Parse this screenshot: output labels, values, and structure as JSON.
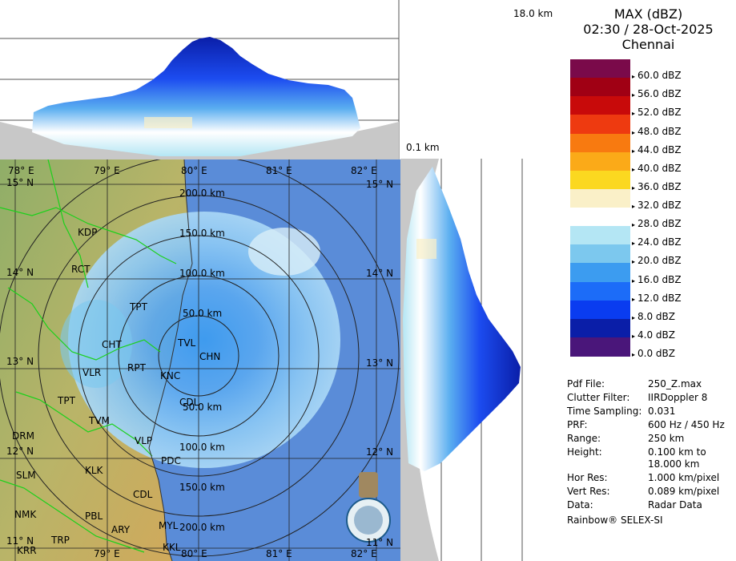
{
  "header": {
    "product": "MAX (dBZ)",
    "datetime": "02:30 / 28-Oct-2025",
    "station": "Chennai"
  },
  "top_panel": {
    "height_label": "18.0 km"
  },
  "side_panel": {
    "height_label": "0.1 km"
  },
  "legend": [
    {
      "label": "60.0 dBZ",
      "color": "#7a0a4a"
    },
    {
      "label": "56.0 dBZ",
      "color": "#a00014"
    },
    {
      "label": "52.0 dBZ",
      "color": "#c80a0a"
    },
    {
      "label": "48.0 dBZ",
      "color": "#ee3a10"
    },
    {
      "label": "44.0 dBZ",
      "color": "#f87a10"
    },
    {
      "label": "40.0 dBZ",
      "color": "#fbaa18"
    },
    {
      "label": "36.0 dBZ",
      "color": "#fbd820"
    },
    {
      "label": "32.0 dBZ",
      "color": "#faf0c8"
    },
    {
      "label": "28.0 dBZ",
      "color": "#ffffff"
    },
    {
      "label": "24.0 dBZ",
      "color": "#b4e6f4"
    },
    {
      "label": "20.0 dBZ",
      "color": "#7cc8ee"
    },
    {
      "label": "16.0 dBZ",
      "color": "#3c9cf0"
    },
    {
      "label": "12.0 dBZ",
      "color": "#1c6cf8"
    },
    {
      "label": "8.0 dBZ",
      "color": "#0a3cf0"
    },
    {
      "label": "4.0 dBZ",
      "color": "#0a1ea8"
    },
    {
      "label": "0.0 dBZ",
      "color": "#4a167a"
    }
  ],
  "map": {
    "lon_labels": [
      "78° E",
      "79° E",
      "80° E",
      "81° E",
      "82° E"
    ],
    "lat_labels": [
      "15° N",
      "14° N",
      "13° N",
      "12° N",
      "11° N"
    ],
    "range_labels": [
      "50.0 km",
      "100.0 km",
      "150.0 km",
      "200.0 km"
    ],
    "places": [
      "KDP",
      "RCT",
      "TPT",
      "CHT",
      "TVL",
      "CHN",
      "VLR",
      "RPT",
      "KNC",
      "TPT",
      "TVM",
      "DRM",
      "VLP",
      "PDC",
      "SLM",
      "KLK",
      "CDL",
      "NMK",
      "PBL",
      "ARY",
      "MYL",
      "TRP",
      "KRR",
      "KKL",
      "CDL"
    ]
  },
  "meta": [
    {
      "key": "Pdf File:",
      "value": "250_Z.max"
    },
    {
      "key": "Clutter Filter:",
      "value": "IIRDoppler 8"
    },
    {
      "key": "Time Sampling:",
      "value": "0.031"
    },
    {
      "key": "PRF:",
      "value": "600 Hz / 450 Hz"
    },
    {
      "key": "Range:",
      "value": "250 km"
    },
    {
      "key": "Height:",
      "value": "0.100 km to"
    },
    {
      "key": "",
      "value": "18.000 km"
    },
    {
      "key": "Hor Res:",
      "value": "1.000 km/pixel"
    },
    {
      "key": "Vert Res:",
      "value": "0.089 km/pixel"
    },
    {
      "key": "Data:",
      "value": "Radar Data"
    }
  ],
  "footer": "Rainbow® SELEX-SI"
}
